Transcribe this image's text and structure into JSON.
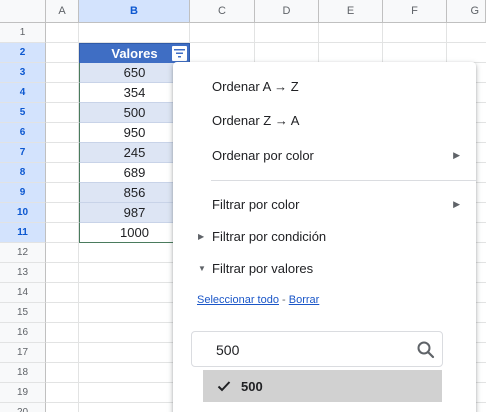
{
  "sheet": {
    "columns": [
      "A",
      "B",
      "C",
      "D",
      "E",
      "F",
      "G"
    ],
    "rows": [
      "1",
      "2",
      "3",
      "4",
      "5",
      "6",
      "7",
      "8",
      "9",
      "10",
      "11",
      "12",
      "13",
      "14",
      "15",
      "16",
      "17",
      "18",
      "19",
      "20"
    ],
    "header": "Valores",
    "values": [
      "650",
      "354",
      "500",
      "950",
      "245",
      "689",
      "856",
      "987",
      "1000"
    ],
    "colors": {
      "header_fill": "#3f6ec4",
      "band_fill": "#dde5f4",
      "link": "#1a56c8"
    }
  },
  "menu": {
    "sort_az": "Ordenar A → Z",
    "sort_za": "Ordenar Z → A",
    "sort_color": "Ordenar por color",
    "filter_color": "Filtrar por color",
    "filter_condition": "Filtrar por condición",
    "filter_values": "Filtrar por valores",
    "select_all": "Seleccionar todo",
    "link_sep": " - ",
    "clear": "Borrar",
    "search_value": "500",
    "checked_value": "500"
  },
  "icons": [
    "filter-icon",
    "submenu-arrow-icon",
    "expand-triangle-icon",
    "search-icon",
    "checkmark-icon"
  ]
}
